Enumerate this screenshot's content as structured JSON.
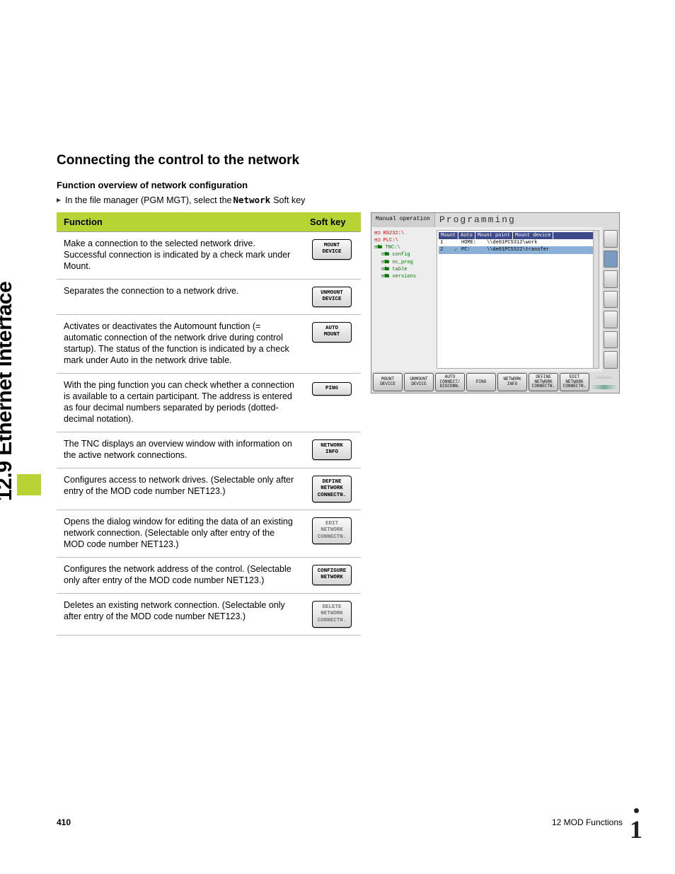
{
  "sidebar": {
    "section_label": "12.9 Ethernet Interface"
  },
  "heading": "Connecting the control to the network",
  "subheading": "Function overview of network configuration",
  "intro": {
    "before": "In the file manager (PGM MGT), select the ",
    "softkey": "Network",
    "after": " Soft key"
  },
  "table": {
    "headers": {
      "function": "Function",
      "softkey": "Soft key"
    },
    "rows": [
      {
        "desc": "Make a connection to the selected network drive. Successful connection is indicated by a check mark under Mount.",
        "key": "MOUNT\nDEVICE"
      },
      {
        "desc": "Separates the connection to a network drive.",
        "key": "UNMOUNT\nDEVICE"
      },
      {
        "desc": "Activates or deactivates the Automount function (= automatic connection of the network drive during control startup). The status of the function is indicated by a check mark under Auto in the network drive table.",
        "key": "AUTO\nMOUNT"
      },
      {
        "desc": "With the ping function you can check whether a connection is available to a certain participant. The address is entered as four decimal numbers separated by periods (dotted-decimal notation).",
        "key": "PING"
      },
      {
        "desc": "The TNC displays an overview window with information on the active network connections.",
        "key": "NETWORK\nINFO"
      },
      {
        "desc": "Configures access to network drives. (Selectable only after entry of the MOD code number NET123.)",
        "key": "DEFINE\nNETWORK\nCONNECTN."
      },
      {
        "desc": "Opens the dialog window for editing the data of an existing network connection. (Selectable only after entry of the MOD code number NET123.)",
        "key": "EDIT\nNETWORK\nCONNECTN.",
        "dim": true
      },
      {
        "desc": "Configures the network address of the control. (Selectable only after entry of the MOD code number NET123.)",
        "key": "CONFIGURE\nNETWORK"
      },
      {
        "desc": "Deletes an existing network connection. (Selectable only after entry of the MOD code number NET123.)",
        "key": "DELETE\nNETWORK\nCONNECTN.",
        "dim": true
      }
    ]
  },
  "screenshot": {
    "mode_small": "Manual operation",
    "mode_large": "Programming",
    "tree": {
      "rs232": "RS232:\\",
      "plc": "PLC:\\",
      "tnc": "TNC:\\",
      "children": [
        "config",
        "nc_prog",
        "table",
        "versions"
      ]
    },
    "grid": {
      "headers": [
        "Mount",
        "Auto",
        "Mount point",
        "Mount device"
      ],
      "rows": [
        {
          "idx": "1",
          "check": "",
          "name": "HOME:",
          "path": "\\\\de01PC5312\\work"
        },
        {
          "idx": "2",
          "check": "✓",
          "name": "PC:",
          "path": "\\\\de01PC5322\\transfer"
        }
      ]
    },
    "footer": [
      "MOUNT\nDEVICE",
      "UNMOUNT\nDEVICE",
      "AUTO\nCONNECT/\nDISCONN.",
      "PING",
      "NETWORK\nINFO",
      "DEFINE\nNETWORK\nCONNECTN.",
      "EDIT\nNETWORK\nCONNECTN."
    ]
  },
  "footer": {
    "page_number": "410",
    "chapter": "12 MOD Functions"
  }
}
